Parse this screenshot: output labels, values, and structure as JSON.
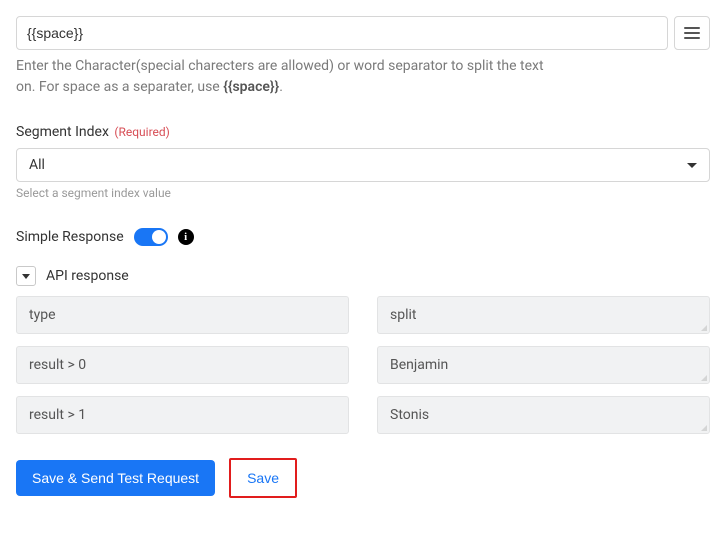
{
  "separator_input": {
    "value": "{{space}}",
    "help_pre": "Enter the Character(special charecters are allowed) or word separator to split the text on. For space as a separater, use ",
    "help_bold": "{{space}}",
    "help_post": "."
  },
  "segment_index": {
    "label": "Segment Index",
    "required": "(Required)",
    "value": "All",
    "hint": "Select a segment index value"
  },
  "simple_response": {
    "label": "Simple Response"
  },
  "api_response": {
    "title": "API response",
    "rows": [
      {
        "key": "type",
        "value": "split"
      },
      {
        "key": "result > 0",
        "value": "Benjamin"
      },
      {
        "key": "result > 1",
        "value": "Stonis"
      }
    ]
  },
  "actions": {
    "save_send": "Save & Send Test Request",
    "save": "Save"
  }
}
